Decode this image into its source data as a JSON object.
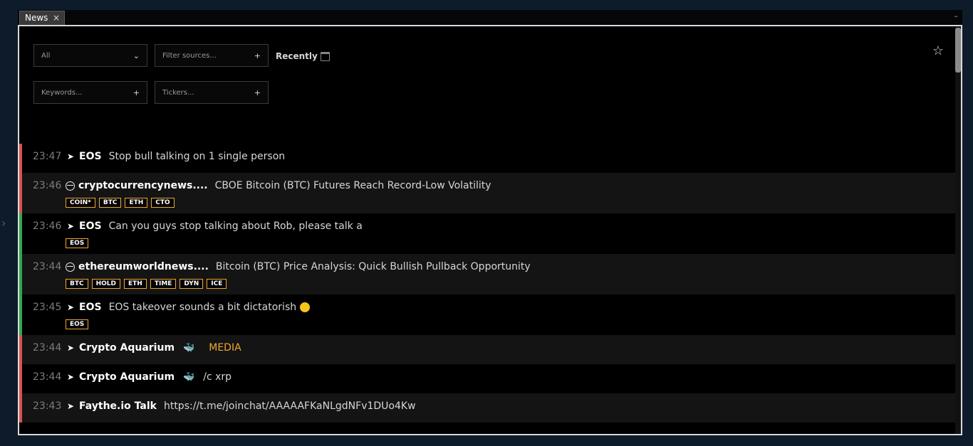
{
  "window": {
    "tab_label": "News",
    "tab_close": "×",
    "minimize": "–"
  },
  "filters": {
    "category": "All",
    "sources_placeholder": "Filter sources...",
    "keywords_placeholder": "Keywords...",
    "tickers_placeholder": "Tickers...",
    "plus": "+",
    "chevron": "⌄",
    "recently": "Recently"
  },
  "icons": {
    "star": "☆",
    "telegram": "➤",
    "whale": "🐳",
    "left_arrow": "›"
  },
  "colors": {
    "bearish": "#d9534f",
    "bullish": "#2fa84f",
    "tag_border": "#f0a830"
  },
  "news": [
    {
      "time": "23:47",
      "type": "telegram",
      "source": "EOS",
      "headline": "Stop bull talking on 1 single person",
      "sentiment": "red",
      "tags": []
    },
    {
      "time": "23:46",
      "type": "web",
      "source": "cryptocurrencynews....",
      "headline": "CBOE Bitcoin (BTC) Futures Reach Record-Low Volatility",
      "sentiment": "red",
      "tags": [
        "COIN*",
        "BTC",
        "ETH",
        "CTO"
      ]
    },
    {
      "time": "23:46",
      "type": "telegram",
      "source": "EOS",
      "headline": "Can you guys stop talking about Rob, please talk a",
      "sentiment": "green",
      "tags": [
        "EOS"
      ]
    },
    {
      "time": "23:44",
      "type": "web",
      "source": "ethereumworldnews....",
      "headline": "Bitcoin (BTC) Price Analysis: Quick Bullish Pullback Opportunity",
      "sentiment": "green",
      "tags": [
        "BTC",
        "HOLD",
        "ETH",
        "TIME",
        "DYN",
        "ICE"
      ]
    },
    {
      "time": "23:45",
      "type": "telegram",
      "source": "EOS",
      "headline": "EOS takeover sounds a bit dictatorish",
      "sentiment": "green",
      "tags": [
        "EOS"
      ]
    },
    {
      "time": "23:44",
      "type": "telegram",
      "source": "Crypto Aquarium",
      "headline": "MEDIA",
      "sentiment": "red",
      "tags": []
    },
    {
      "time": "23:44",
      "type": "telegram",
      "source": "Crypto Aquarium",
      "headline": "/c xrp",
      "sentiment": "red",
      "tags": []
    },
    {
      "time": "23:43",
      "type": "telegram",
      "source": "Faythe.io Talk",
      "headline": "https://t.me/joinchat/AAAAAFKaNLgdNFv1DUo4Kw",
      "sentiment": "red",
      "tags": []
    }
  ]
}
